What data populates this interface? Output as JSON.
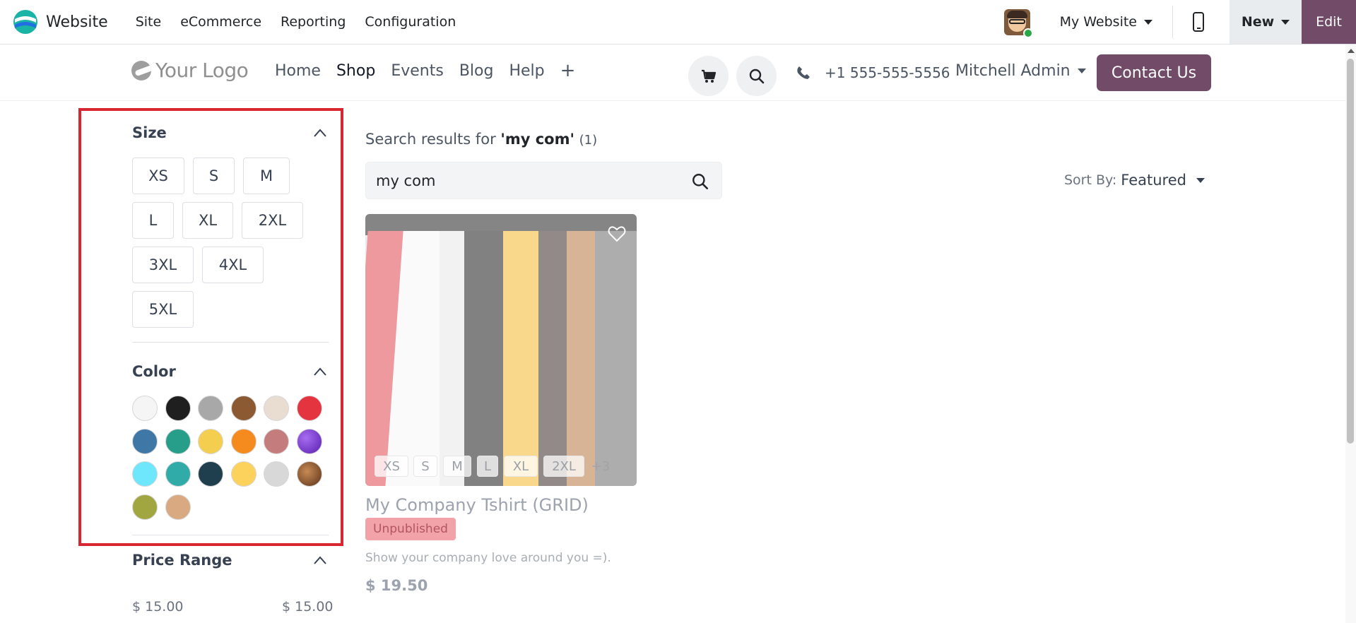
{
  "admin_bar": {
    "app_name": "Website",
    "menu": [
      "Site",
      "eCommerce",
      "Reporting",
      "Configuration"
    ],
    "website_selector": "My Website",
    "new_label": "New",
    "edit_label": "Edit",
    "accent_color": "#714b67"
  },
  "site_header": {
    "logo_text": "Your Logo",
    "nav": [
      "Home",
      "Shop",
      "Events",
      "Blog",
      "Help"
    ],
    "active_nav": "Shop",
    "add_icon": "plus-icon",
    "phone": "+1 555-555-5556",
    "user": "Mitchell Admin",
    "contact_label": "Contact Us"
  },
  "filters": {
    "size": {
      "title": "Size",
      "options": [
        "XS",
        "S",
        "M",
        "L",
        "XL",
        "2XL",
        "3XL",
        "4XL",
        "5XL"
      ]
    },
    "color": {
      "title": "Color",
      "swatches": [
        "#f5f5f5",
        "#1f1f1f",
        "#a8a8a8",
        "#8b5a33",
        "#e8ddd0",
        "#e3343f",
        "#3f77a6",
        "#279e8a",
        "#f4cf4f",
        "#f58a1f",
        "#c47c7c",
        "#7a3fc8",
        "#6ee6fb",
        "#31aba8",
        "#1f3f4f",
        "#fdd25c",
        "#d8d8d8",
        "#7a4a2a",
        "#a2a640",
        "#d9aa82"
      ]
    },
    "price_range": {
      "title": "Price Range",
      "min": "$ 15.00",
      "max": "$ 15.00"
    }
  },
  "results": {
    "prefix": "Search results for ",
    "query_display": "'my com'",
    "count": "(1)",
    "search_value": "my com",
    "sort_label": "Sort By:",
    "sort_value": "Featured"
  },
  "product": {
    "name": "My Company Tshirt (GRID)",
    "badge": "Unpublished",
    "description": "Show your company love around you =).",
    "price": "$ 19.50",
    "size_chips": [
      "XS",
      "S",
      "M",
      "L",
      "XL",
      "2XL"
    ],
    "more": "+3"
  }
}
